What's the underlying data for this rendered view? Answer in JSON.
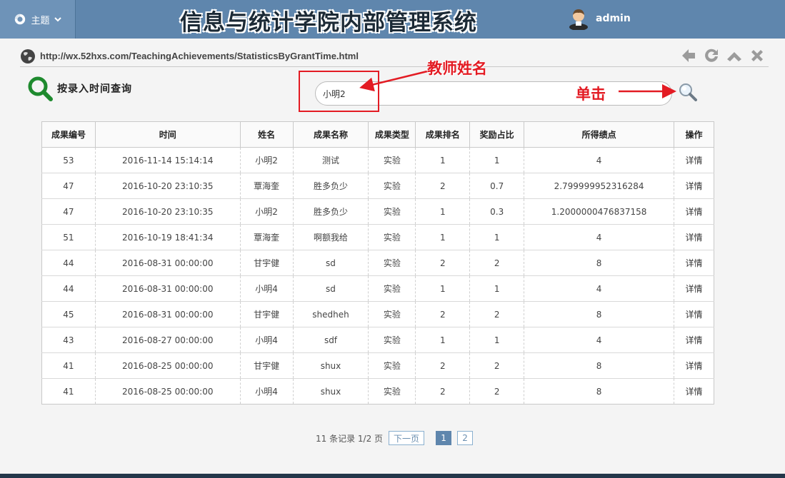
{
  "header": {
    "theme_label": "主题",
    "system_title": "信息与统计学院内部管理系统",
    "username": "admin"
  },
  "urlbar": {
    "url": "http://wx.52hxs.com/TeachingAchievements/StatisticsByGrantTime.html"
  },
  "query": {
    "title": "按录入时间查询",
    "search_value": "小明2"
  },
  "annotations": {
    "teacher_name": "教师姓名",
    "click": "单击",
    "color": "#e31b23"
  },
  "table": {
    "headers": [
      "成果编号",
      "时间",
      "姓名",
      "成果名称",
      "成果类型",
      "成果排名",
      "奖励占比",
      "所得绩点",
      "操作"
    ],
    "rows": [
      [
        "53",
        "2016-11-14 15:14:14",
        "小明2",
        "测试",
        "实验",
        "1",
        "1",
        "4",
        "详情"
      ],
      [
        "47",
        "2016-10-20 23:10:35",
        "覃海奎",
        "胜多负少",
        "实验",
        "2",
        "0.7",
        "2.799999952316284",
        "详情"
      ],
      [
        "47",
        "2016-10-20 23:10:35",
        "小明2",
        "胜多负少",
        "实验",
        "1",
        "0.3",
        "1.2000000476837158",
        "详情"
      ],
      [
        "51",
        "2016-10-19 18:41:34",
        "覃海奎",
        "啊额我给",
        "实验",
        "1",
        "1",
        "4",
        "详情"
      ],
      [
        "44",
        "2016-08-31 00:00:00",
        "甘宇健",
        "sd",
        "实验",
        "2",
        "2",
        "8",
        "详情"
      ],
      [
        "44",
        "2016-08-31 00:00:00",
        "小明4",
        "sd",
        "实验",
        "1",
        "1",
        "4",
        "详情"
      ],
      [
        "45",
        "2016-08-31 00:00:00",
        "甘宇健",
        "shedheh",
        "实验",
        "2",
        "2",
        "8",
        "详情"
      ],
      [
        "43",
        "2016-08-27 00:00:00",
        "小明4",
        "sdf",
        "实验",
        "1",
        "1",
        "4",
        "详情"
      ],
      [
        "41",
        "2016-08-25 00:00:00",
        "甘宇健",
        "shux",
        "实验",
        "2",
        "2",
        "8",
        "详情"
      ],
      [
        "41",
        "2016-08-25 00:00:00",
        "小明4",
        "shux",
        "实验",
        "2",
        "2",
        "8",
        "详情"
      ]
    ]
  },
  "pager": {
    "summary": "11 条记录 1/2 页",
    "next_label": "下一页",
    "pages": [
      "1",
      "2"
    ],
    "current_page": "1"
  },
  "colors": {
    "header_bg": "#5f86ad",
    "accent": "#5f86ad",
    "search_icon_green": "#1e8a2e"
  },
  "icons": [
    "theme-icon",
    "chevron-down-icon",
    "avatar",
    "globe-icon",
    "back-arrow-icon",
    "refresh-icon",
    "collapse-up-icon",
    "close-icon",
    "search-icon",
    "magnifier-icon"
  ]
}
